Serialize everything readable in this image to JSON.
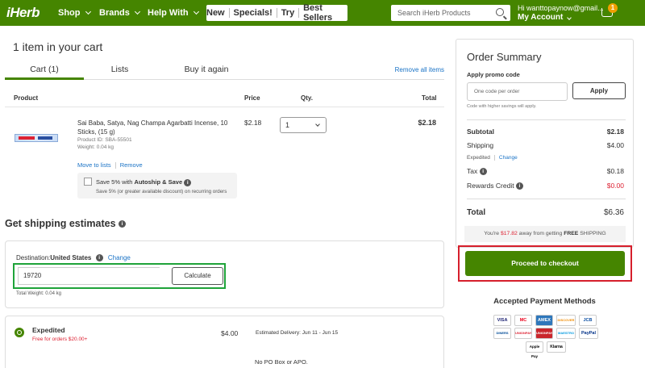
{
  "header": {
    "logo": "iHerb",
    "nav": [
      "Shop",
      "Brands",
      "Help With"
    ],
    "promo_links": [
      "New",
      "Specials!",
      "Try",
      "Best Sellers"
    ],
    "search_placeholder": "Search iHerb Products",
    "greeting": "Hi wanttopaynow@gmail...",
    "account": "My Account",
    "cart_count": "1",
    "brand_color": "#458500"
  },
  "cart": {
    "title": "1 item in your cart",
    "tabs": [
      "Cart (1)",
      "Lists",
      "Buy it again"
    ],
    "remove_all": "Remove all items",
    "columns": [
      "Product",
      "Price",
      "Qty.",
      "Total"
    ],
    "item": {
      "name": "Sai Baba, Satya, Nag Champa Agarbatti Incense, 10 Sticks, (15 g)",
      "product_id": "Product ID: SBA-55501",
      "weight": "Weight: 0.04 kg",
      "price": "$2.18",
      "qty": "1",
      "total": "$2.18",
      "move_to_lists": "Move to lists",
      "remove": "Remove"
    },
    "autoship": {
      "title_prefix": "Save 5% with ",
      "title_bold": "Autoship & Save",
      "subtitle": "Save 5% (or greater available discount) on recurring orders"
    }
  },
  "shipping": {
    "title": "Get shipping estimates",
    "destination_label": "Destination:",
    "destination_value": "United States",
    "change": "Change",
    "zip_value": "19720",
    "calculate": "Calculate",
    "total_weight": "Total Weight: 0.04 kg",
    "option": {
      "name": "Expedited",
      "free_note": "Free for orders $20.00+",
      "price": "$4.00",
      "delivery": "Estimated Delivery: Jun 11 - Jun 15",
      "po_note": "No PO Box or APO."
    }
  },
  "summary": {
    "title": "Order Summary",
    "promo_label": "Apply promo code",
    "promo_placeholder": "One code per order",
    "apply": "Apply",
    "code_note": "Code with higher savings will apply.",
    "subtotal_label": "Subtotal",
    "subtotal": "$2.18",
    "shipping_label": "Shipping",
    "shipping": "$4.00",
    "shipping_method": "Expedited",
    "shipping_change": "Change",
    "tax_label": "Tax",
    "tax": "$0.18",
    "rewards_label": "Rewards Credit",
    "rewards": "$0.00",
    "total_label": "Total",
    "total": "$6.36",
    "free_ship_prefix": "You're ",
    "free_ship_amount": "$17.82",
    "free_ship_middle": " away from getting ",
    "free_ship_bold": "FREE",
    "free_ship_suffix": " SHIPPING",
    "checkout": "Proceed to checkout"
  },
  "payments": {
    "title": "Accepted Payment Methods",
    "methods": [
      "VISA",
      "MC",
      "AMEX",
      "DISCOVER",
      "JCB",
      "DINERS",
      "UNIONPAY",
      "MAESTRO",
      "PayPal",
      "Apple Pay",
      "Klarna"
    ]
  }
}
